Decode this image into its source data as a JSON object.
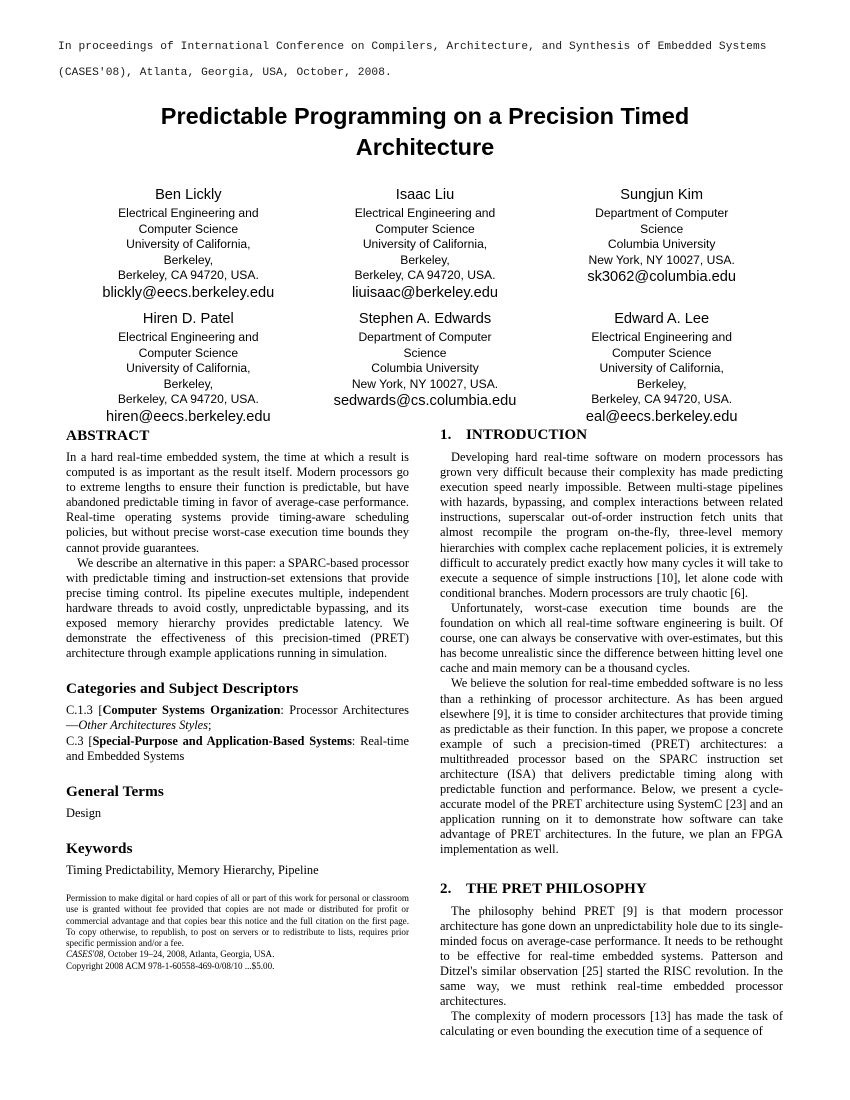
{
  "proceedings_header": "In proceedings of International Conference on Compilers, Architecture, and Synthesis of Embedded Systems (CASES'08), Atlanta, Georgia, USA, October, 2008.",
  "title": "Predictable Programming on a Precision Timed Architecture",
  "authors": [
    {
      "name": "Ben Lickly",
      "affiliation": [
        "Electrical Engineering and",
        "Computer Science",
        "University of California,",
        "Berkeley,",
        "Berkeley, CA 94720, USA."
      ],
      "email": "blickly@eecs.berkeley.edu"
    },
    {
      "name": "Isaac Liu",
      "affiliation": [
        "Electrical Engineering and",
        "Computer Science",
        "University of California,",
        "Berkeley,",
        "Berkeley, CA 94720, USA."
      ],
      "email": "liuisaac@berkeley.edu"
    },
    {
      "name": "Sungjun Kim",
      "affiliation": [
        "Department of Computer",
        "Science",
        "Columbia University",
        "New York, NY 10027, USA."
      ],
      "email": "sk3062@columbia.edu"
    },
    {
      "name": "Hiren D. Patel",
      "affiliation": [
        "Electrical Engineering and",
        "Computer Science",
        "University of California,",
        "Berkeley,",
        "Berkeley, CA 94720, USA."
      ],
      "email": "hiren@eecs.berkeley.edu"
    },
    {
      "name": "Stephen A. Edwards",
      "affiliation": [
        "Department of Computer",
        "Science",
        "Columbia University",
        "New York, NY 10027, USA."
      ],
      "email": "sedwards@cs.columbia.edu"
    },
    {
      "name": "Edward A. Lee",
      "affiliation": [
        "Electrical Engineering and",
        "Computer Science",
        "University of California,",
        "Berkeley,",
        "Berkeley, CA 94720, USA."
      ],
      "email": "eal@eecs.berkeley.edu"
    }
  ],
  "left_column": {
    "abstract_heading": "ABSTRACT",
    "abstract_p1": "In a hard real-time embedded system, the time at which a result is computed is as important as the result itself. Modern processors go to extreme lengths to ensure their function is predictable, but have abandoned predictable timing in favor of average-case performance. Real-time operating systems provide timing-aware scheduling policies, but without precise worst-case execution time bounds they cannot provide guarantees.",
    "abstract_p2": "We describe an alternative in this paper: a SPARC-based processor with predictable timing and instruction-set extensions that provide precise timing control. Its pipeline executes multiple, independent hardware threads to avoid costly, unpredictable bypassing, and its exposed memory hierarchy provides predictable latency. We demonstrate the effectiveness of this precision-timed (PRET) architecture through example applications running in simulation.",
    "categories_heading": "Categories and Subject Descriptors",
    "category_1": {
      "code": "C.1.3",
      "bracket_bold": "Computer Systems Organization",
      "tail_plain": ": Processor Architectures—",
      "tail_italic": "Other Architectures Styles",
      "tail_end": ";"
    },
    "category_2": {
      "code": "C.3",
      "bracket_bold": "Special-Purpose and Application-Based Systems",
      "tail_plain": ": Real-time and Embedded Systems"
    },
    "general_terms_heading": "General Terms",
    "general_terms_text": "Design",
    "keywords_heading": "Keywords",
    "keywords_text": "Timing Predictability, Memory Hierarchy, Pipeline"
  },
  "copyright": {
    "permission": "Permission to make digital or hard copies of all or part of this work for personal or classroom use is granted without fee provided that copies are not made or distributed for profit or commercial advantage and that copies bear this notice and the full citation on the first page. To copy otherwise, to republish, to post on servers or to redistribute to lists, requires prior specific permission and/or a fee.",
    "venue_italic": "CASES'08,",
    "venue_rest": " October 19–24, 2008, Atlanta, Georgia, USA.",
    "acm_line": "Copyright 2008 ACM 978-1-60558-469-0/08/10 ...$5.00."
  },
  "right_column": {
    "intro_num": "1.",
    "intro_heading": "INTRODUCTION",
    "intro_p1": "Developing hard real-time software on modern processors has grown very difficult because their complexity has made predicting execution speed nearly impossible. Between multi-stage pipelines with hazards, bypassing, and complex interactions between related instructions, superscalar out-of-order instruction fetch units that almost recompile the program on-the-fly, three-level memory hierarchies with complex cache replacement policies, it is extremely difficult to accurately predict exactly how many cycles it will take to execute a sequence of simple instructions [10], let alone code with conditional branches. Modern processors are truly chaotic [6].",
    "intro_p2": "Unfortunately, worst-case execution time bounds are the foundation on which all real-time software engineering is built. Of course, one can always be conservative with over-estimates, but this has become unrealistic since the difference between hitting level one cache and main memory can be a thousand cycles.",
    "intro_p3": "We believe the solution for real-time embedded software is no less than a rethinking of processor architecture. As has been argued elsewhere [9], it is time to consider architectures that provide timing as predictable as their function. In this paper, we propose a concrete example of such a precision-timed (PRET) architectures: a multithreaded processor based on the SPARC instruction set architecture (ISA) that delivers predictable timing along with predictable function and performance. Below, we present a cycle-accurate model of the PRET architecture using SystemC [23] and an application running on it to demonstrate how software can take advantage of PRET architectures. In the future, we plan an FPGA implementation as well.",
    "philosophy_num": "2.",
    "philosophy_heading": "THE PRET PHILOSOPHY",
    "philosophy_p1": "The philosophy behind PRET [9] is that modern processor architecture has gone down an unpredictability hole due to its single-minded focus on average-case performance. It needs to be rethought to be effective for real-time embedded systems. Patterson and Ditzel's similar observation [25] started the RISC revolution. In the same way, we must rethink real-time embedded processor architectures.",
    "philosophy_p2": "The complexity of modern processors [13] has made the task of calculating or even bounding the execution time of a sequence of"
  }
}
